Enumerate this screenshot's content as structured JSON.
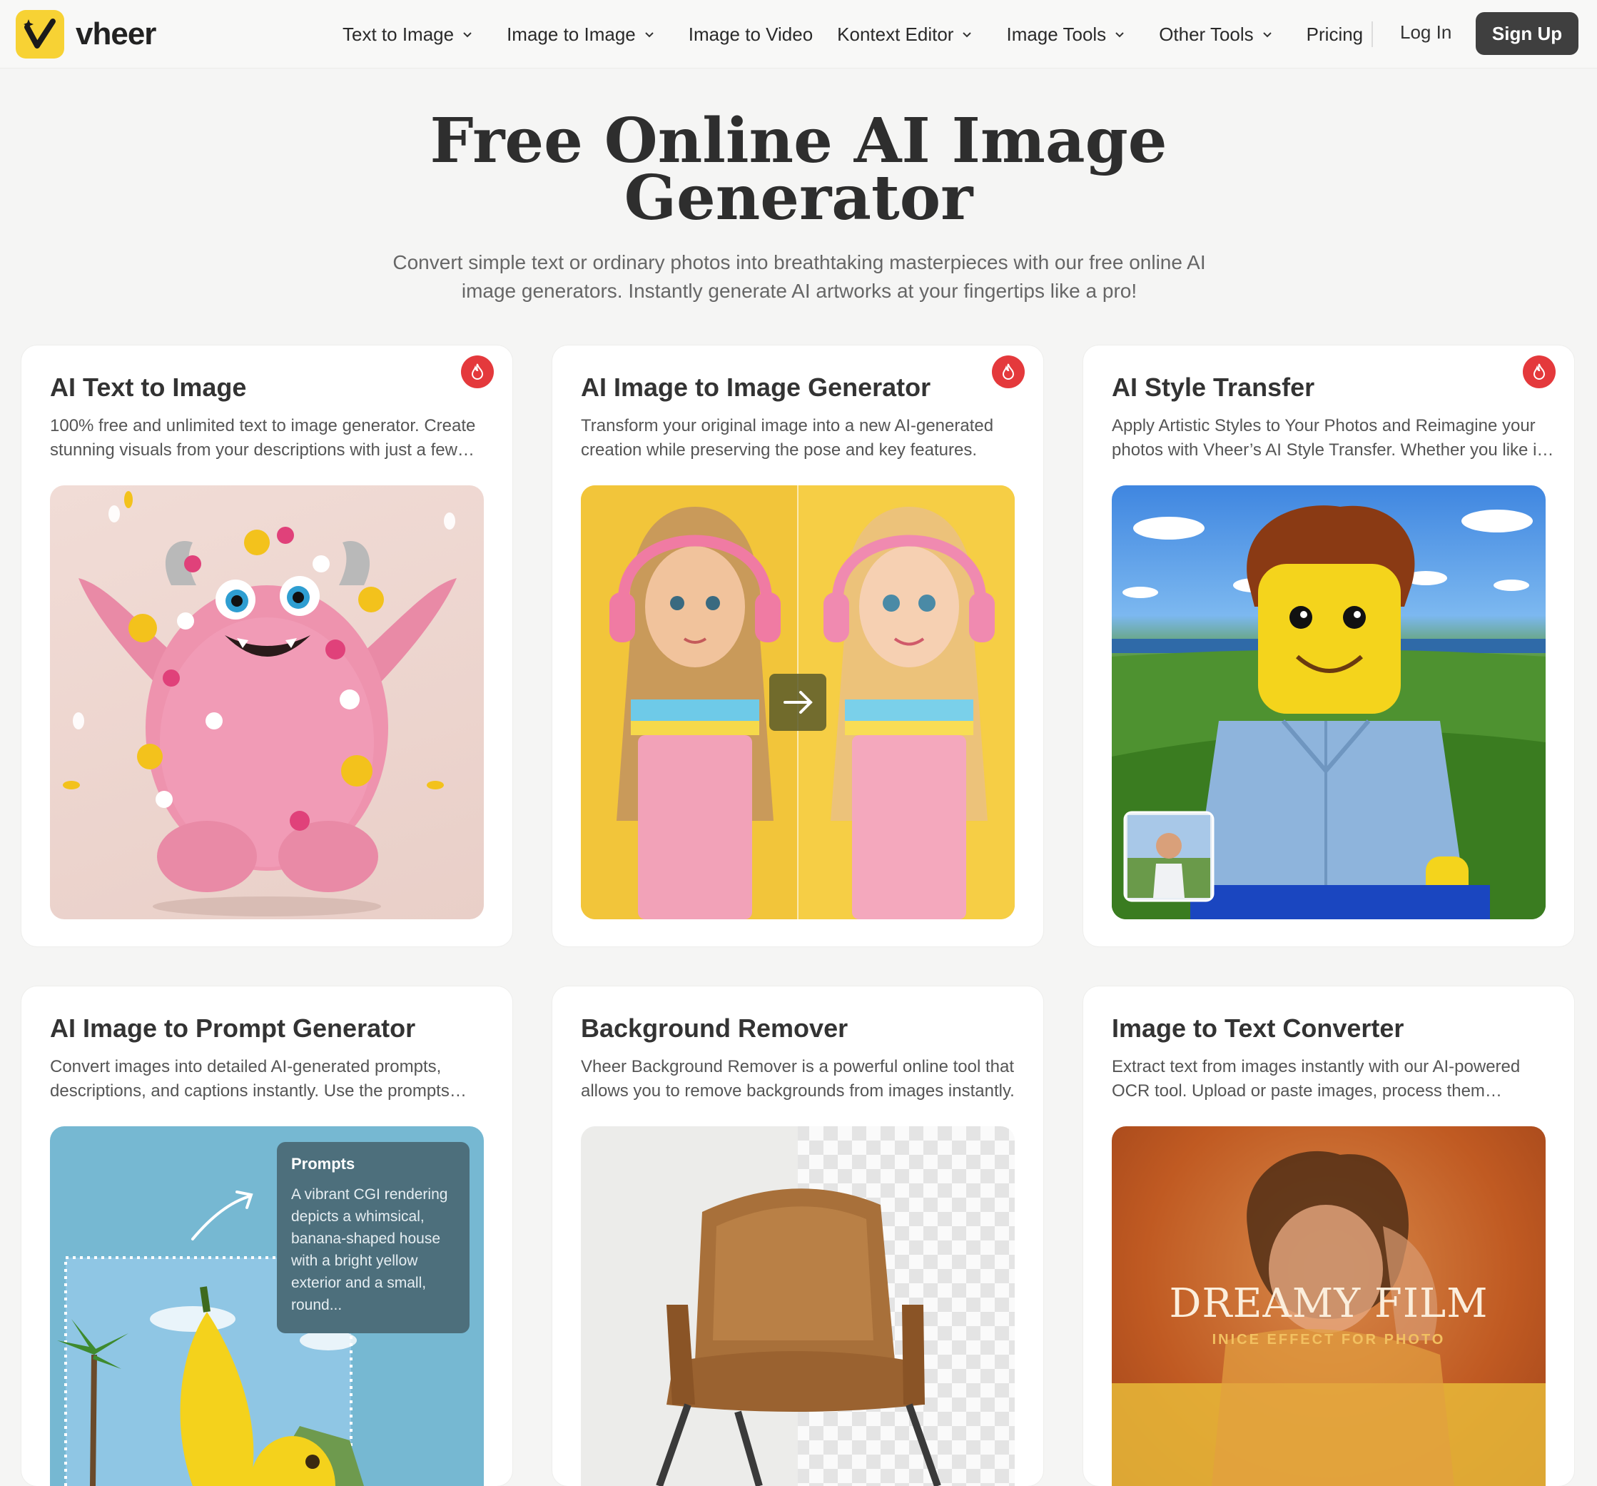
{
  "brand": {
    "name": "vheer"
  },
  "nav": {
    "items": [
      {
        "label": "Text to Image",
        "has_dropdown": true
      },
      {
        "label": "Image to Image",
        "has_dropdown": true
      },
      {
        "label": "Image to Video",
        "has_dropdown": false
      },
      {
        "label": "Kontext Editor",
        "has_dropdown": true
      },
      {
        "label": "Image Tools",
        "has_dropdown": true
      },
      {
        "label": "Other Tools",
        "has_dropdown": true
      },
      {
        "label": "Pricing",
        "has_dropdown": false
      }
    ],
    "login": "Log In",
    "signup": "Sign Up"
  },
  "hero": {
    "title_line1": "Free Online AI Image",
    "title_line2": "Generator",
    "subtitle": "Convert simple text or ordinary photos into breathtaking masterpieces with our free online AI image generators. Instantly generate AI artworks at your fingertips like a pro!"
  },
  "cards": [
    {
      "title": "AI Text to Image",
      "description": "100% free and unlimited text to image generator. Create stunning visuals from your descriptions with just a few words.",
      "hot": true,
      "image_icon": "pink-monster-image"
    },
    {
      "title": "AI Image to Image Generator",
      "description": "Transform your original image into a new AI-generated creation while preserving the pose and key features.",
      "hot": true,
      "image_icon": "girl-headphones-image"
    },
    {
      "title": "AI Style Transfer",
      "description": "Apply Artistic Styles to Your Photos and Reimagine your photos with Vheer’s AI Style Transfer. Whether you like it or not.",
      "hot": true,
      "image_icon": "lego-man-image"
    },
    {
      "title": "AI Image to Prompt Generator",
      "description": "Convert images into detailed AI-generated prompts, descriptions, and captions instantly. Use the prompts anywhere.",
      "hot": false,
      "image_icon": "banana-house-image",
      "overlay_title": "Prompts",
      "overlay_text": "A vibrant CGI rendering depicts a whimsical, banana-shaped house with a bright yellow exterior and a small, round..."
    },
    {
      "title": "Background Remover",
      "description": "Vheer Background Remover is a powerful online tool that allows you to remove backgrounds from images instantly.",
      "hot": false,
      "image_icon": "armchair-image"
    },
    {
      "title": "Image to Text Converter",
      "description": "Extract text from images instantly with our AI-powered OCR tool. Upload or paste images, process them instantly.",
      "hot": false,
      "image_icon": "dreamy-film-image",
      "overlay_title": "DREAMY FILM",
      "overlay_text": "INICE EFFECT FOR PHOTO"
    }
  ],
  "colors": {
    "accent_yellow": "#f7d234",
    "hot_red": "#e4393c",
    "signup_bg": "#3f3f3f",
    "page_bg": "#f5f5f4"
  }
}
